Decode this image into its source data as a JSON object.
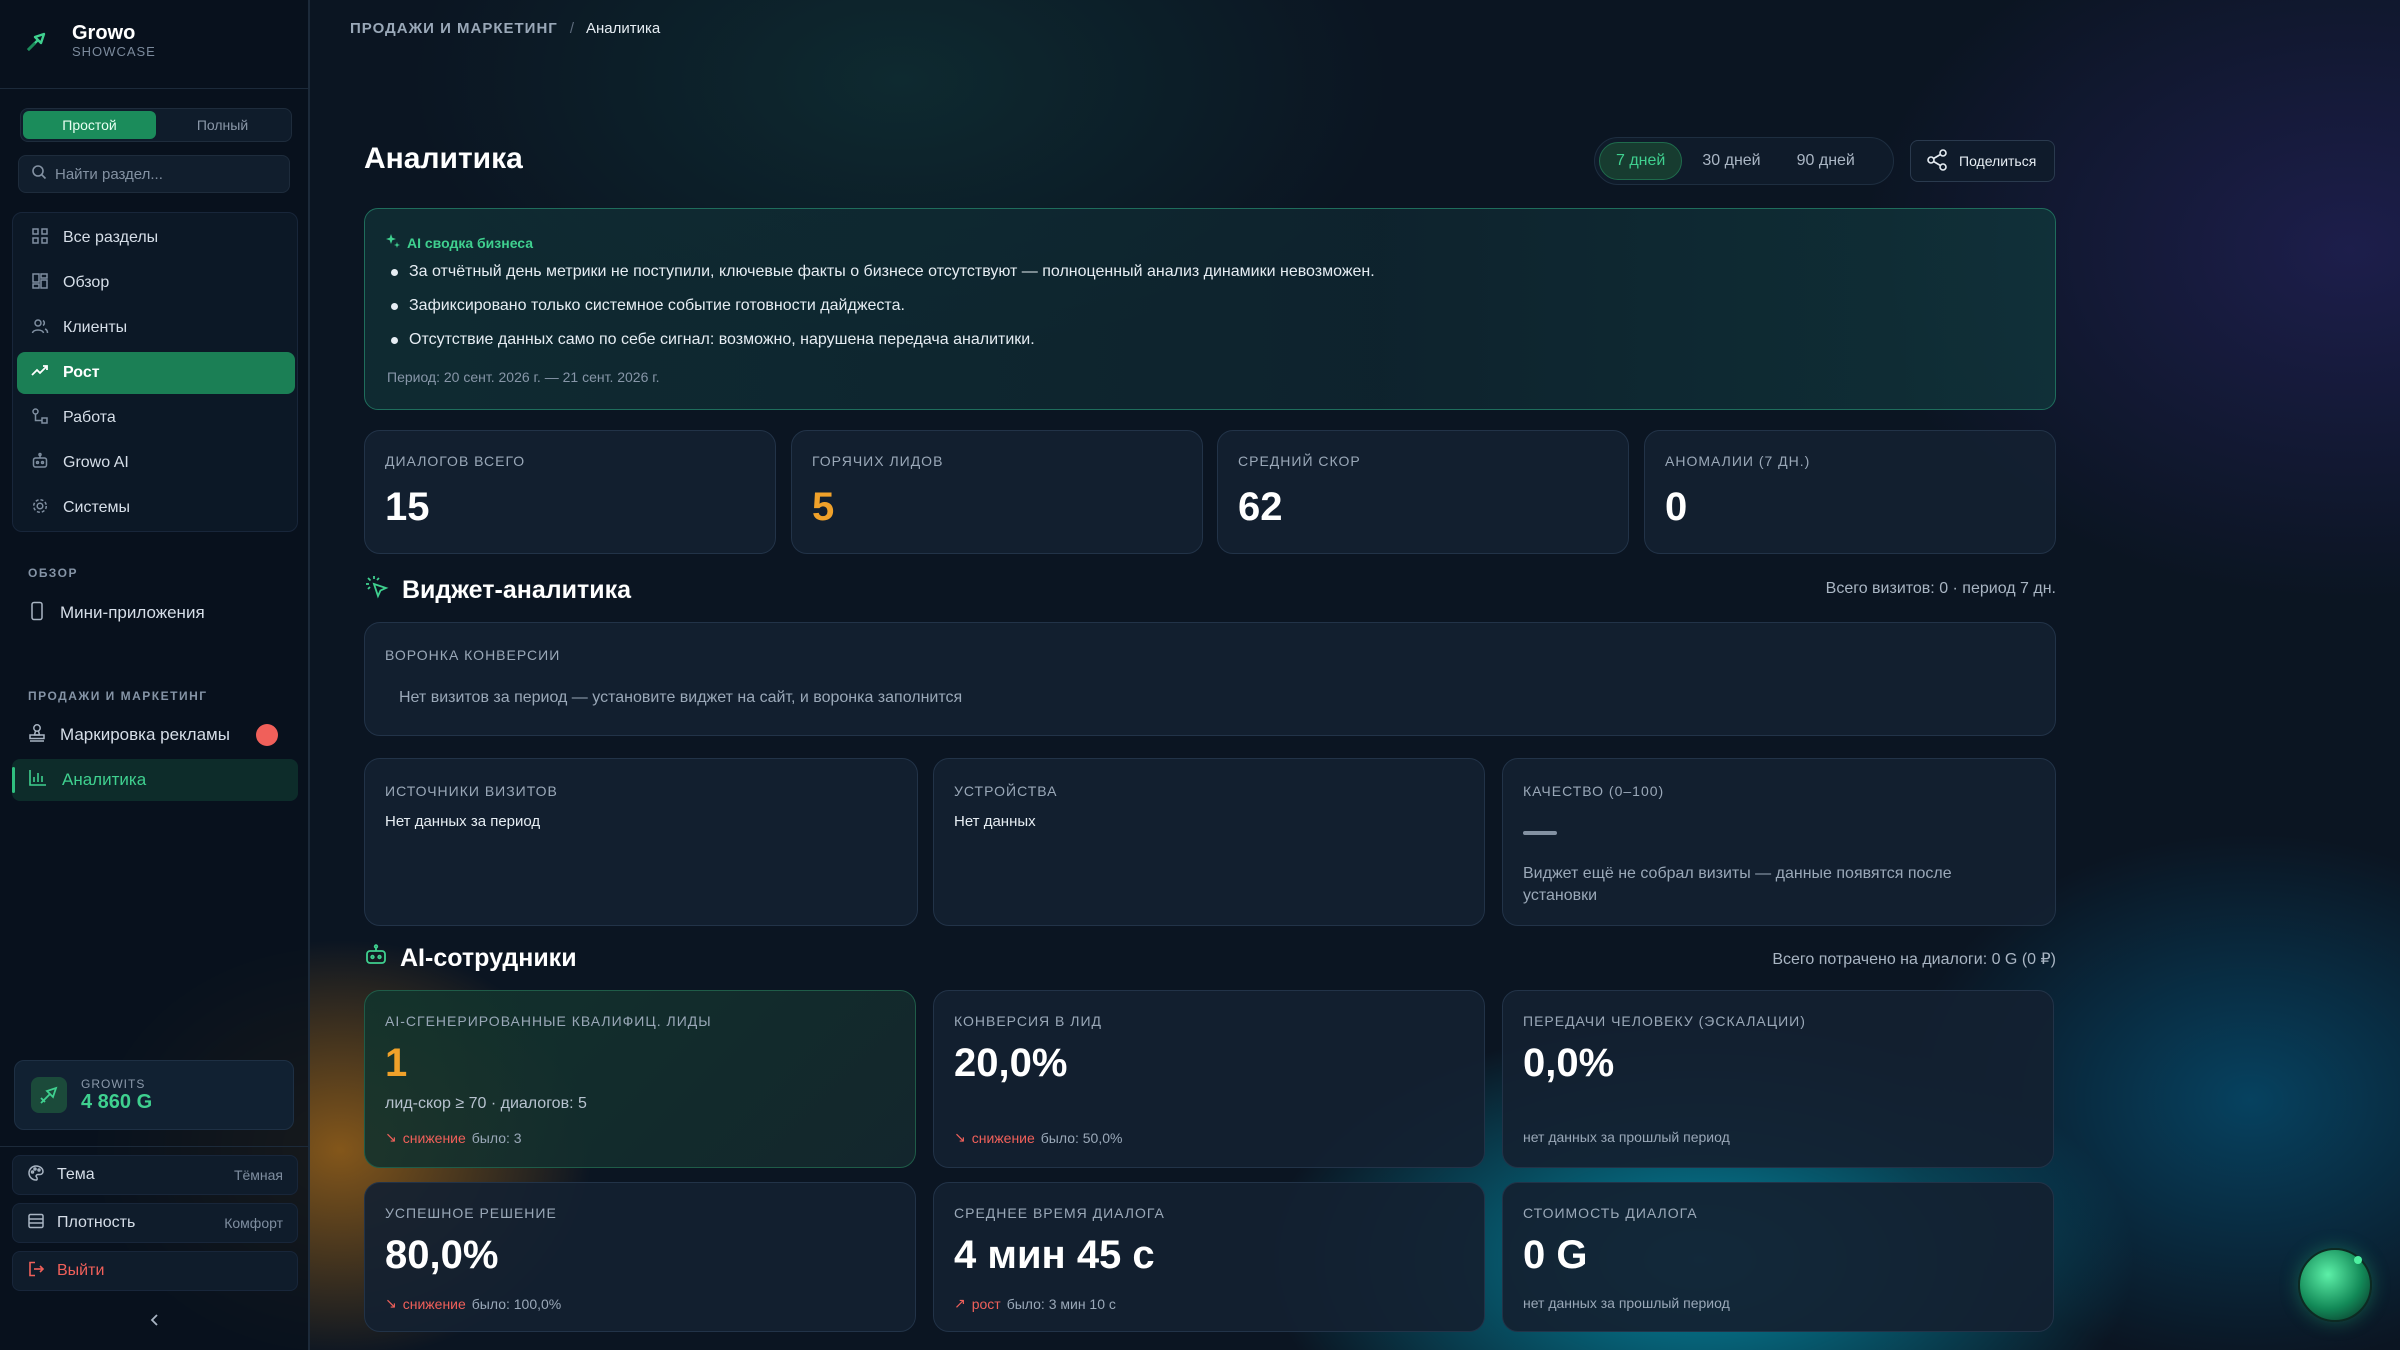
{
  "brand": {
    "name": "Growo",
    "sub": "SHOWCASE"
  },
  "mode": {
    "simple": "Простой",
    "full": "Полный"
  },
  "search": {
    "placeholder": "Найти раздел..."
  },
  "nav": [
    {
      "label": "Все разделы",
      "icon": "grid-icon"
    },
    {
      "label": "Обзор",
      "icon": "dashboard-icon"
    },
    {
      "label": "Клиенты",
      "icon": "users-icon"
    },
    {
      "label": "Рост",
      "icon": "trend-icon"
    },
    {
      "label": "Работа",
      "icon": "workflow-icon"
    },
    {
      "label": "Growo AI",
      "icon": "bot-icon"
    },
    {
      "label": "Системы",
      "icon": "gear-icon"
    }
  ],
  "sections": {
    "overview": {
      "title": "ОБЗОР",
      "items": [
        {
          "label": "Мини-приложения"
        }
      ]
    },
    "sales": {
      "title": "ПРОДАЖИ И МАРКЕТИНГ",
      "items": [
        {
          "label": "Маркировка рекламы"
        },
        {
          "label": "Аналитика"
        }
      ]
    }
  },
  "wallet": {
    "label": "GROWITS",
    "value": "4 860 G"
  },
  "settings": {
    "theme": "Тема",
    "theme_val": "Тёмная",
    "density": "Плотность",
    "density_val": "Комфорт",
    "logout": "Выйти"
  },
  "breadcrumb": {
    "section": "ПРОДАЖИ И МАРКЕТИНГ",
    "sep": "/",
    "current": "Аналитика"
  },
  "page": {
    "title": "Аналитика"
  },
  "periods": [
    "7 дней",
    "30 дней",
    "90 дней"
  ],
  "share": {
    "label": "Поделиться"
  },
  "ai_summary": {
    "title": "AI сводка бизнеса",
    "items": [
      "За отчётный день метрики не поступили, ключевые факты о бизнесе отсутствуют — полноценный анализ динамики невозможен.",
      "Зафиксировано только системное событие готовности дайджеста.",
      "Отсутствие данных само по себе сигнал: возможно, нарушена передача аналитики."
    ],
    "period": "Период: 20 сент. 2026 г. — 21 сент. 2026 г."
  },
  "kpis": [
    {
      "label": "ДИАЛОГОВ ВСЕГО",
      "value": "15"
    },
    {
      "label": "ГОРЯЧИХ ЛИДОВ",
      "value": "5"
    },
    {
      "label": "СРЕДНИЙ СКОР",
      "value": "62"
    },
    {
      "label": "АНОМАЛИИ (7 ДН.)",
      "value": "0"
    }
  ],
  "widget": {
    "title": "Виджет-аналитика",
    "meta": "Всего визитов: 0 · период 7 дн.",
    "funnel": {
      "label": "ВОРОНКА КОНВЕРСИИ",
      "text": "Нет визитов за период — установите виджет на сайт, и воронка заполнится"
    },
    "sources": {
      "label": "ИСТОЧНИКИ ВИЗИТОВ",
      "text": "Нет данных за период"
    },
    "devices": {
      "label": "УСТРОЙСТВА",
      "text": "Нет данных"
    },
    "quality": {
      "label": "КАЧЕСТВО (0–100)",
      "text": "Виджет ещё не собрал визиты — данные появятся после установки"
    }
  },
  "ai_staff": {
    "title": "AI-сотрудники",
    "meta": "Всего потрачено на диалоги: 0 G (0 ₽)",
    "metrics": [
      {
        "label": "AI-СГЕНЕРИРОВАННЫЕ КВАЛИФИЦ. ЛИДЫ",
        "value": "1",
        "sub": "лид-скор ≥ 70 · диалогов: 5",
        "trend": "снижение",
        "prev": "было: 3"
      },
      {
        "label": "КОНВЕРСИЯ В ЛИД",
        "value": "20,0%",
        "trend": "снижение",
        "prev": "было: 50,0%"
      },
      {
        "label": "ПЕРЕДАЧИ ЧЕЛОВЕКУ (ЭСКАЛАЦИИ)",
        "value": "0,0%",
        "note": "нет данных за прошлый период"
      },
      {
        "label": "УСПЕШНОЕ РЕШЕНИЕ",
        "value": "80,0%",
        "trend": "снижение",
        "prev": "было: 100,0%"
      },
      {
        "label": "СРЕДНЕЕ ВРЕМЯ ДИАЛОГА",
        "value": "4 мин 45 с",
        "trend": "рост",
        "prev": "было: 3 мин 10 с"
      },
      {
        "label": "СТОИМОСТЬ ДИАЛОГА",
        "value": "0 G",
        "note": "нет данных за прошлый период"
      }
    ]
  },
  "colors": {
    "accent": "#1b8c5b",
    "accent_text": "#3fd08f",
    "warning": "#f0a12a",
    "danger": "#f0605a",
    "background": "#0b1522"
  }
}
